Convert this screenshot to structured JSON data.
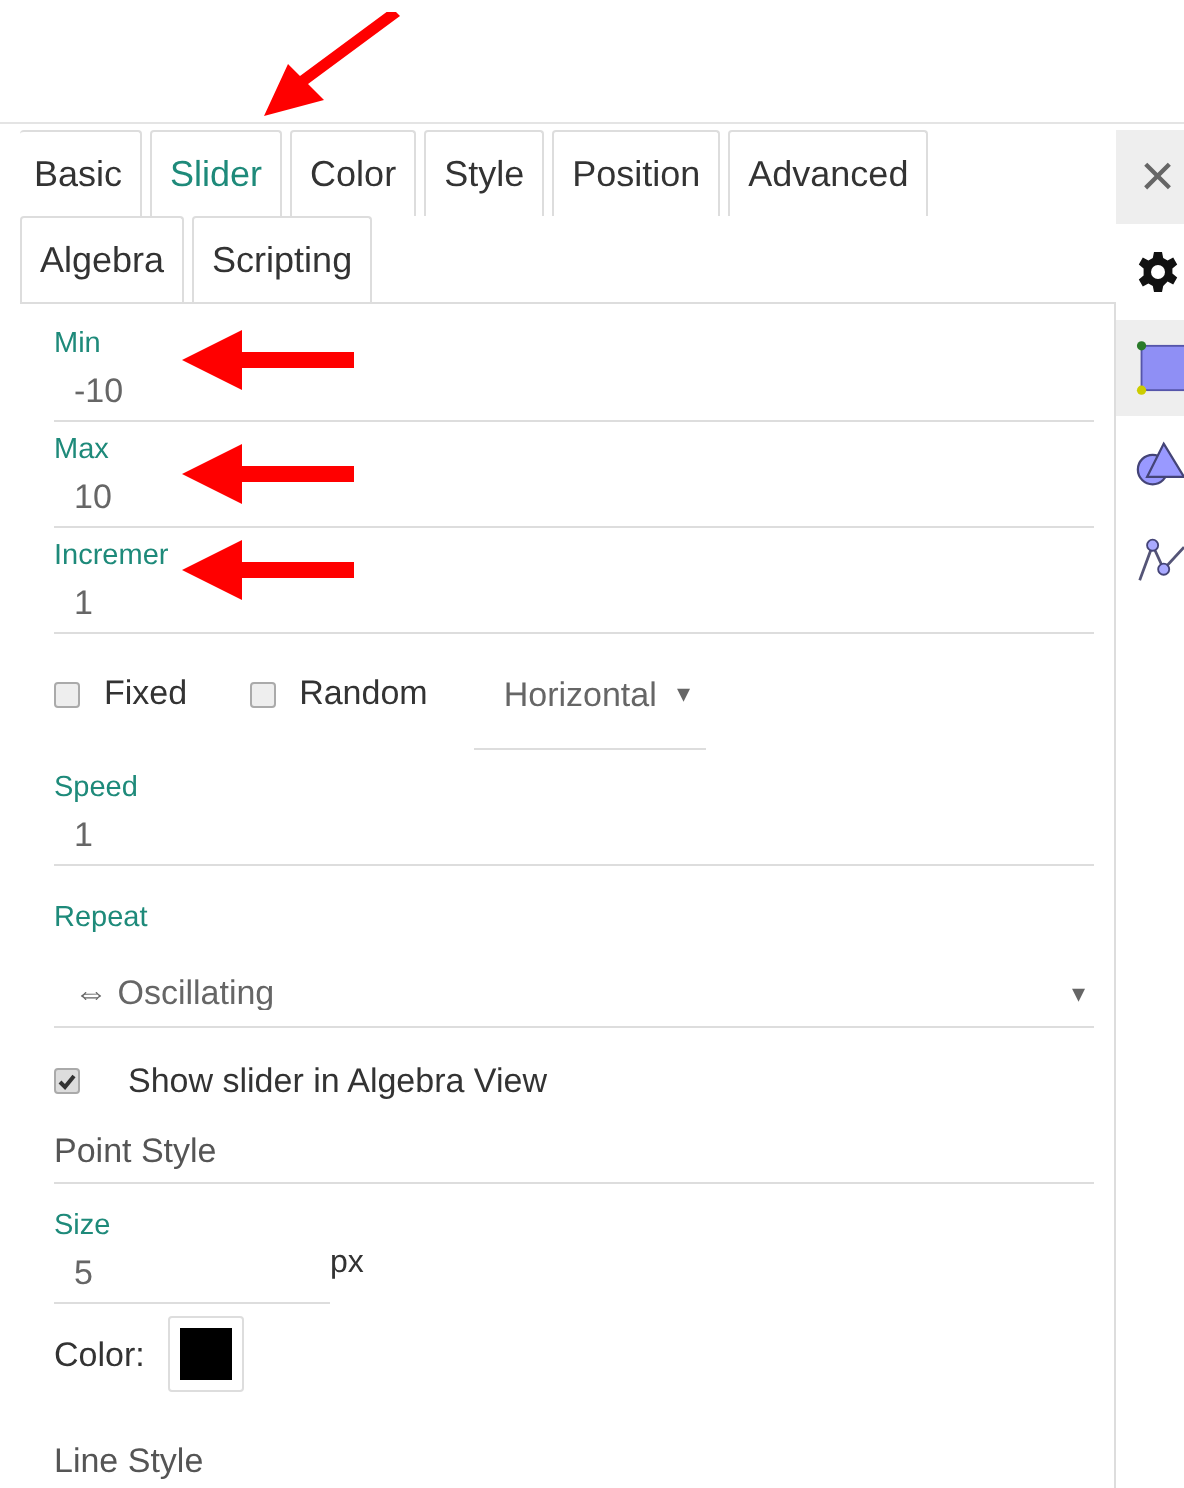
{
  "tabs": [
    {
      "label": "Basic",
      "selected": false
    },
    {
      "label": "Slider",
      "selected": true
    },
    {
      "label": "Color",
      "selected": false
    },
    {
      "label": "Style",
      "selected": false
    },
    {
      "label": "Position",
      "selected": false
    },
    {
      "label": "Advanced",
      "selected": false
    },
    {
      "label": "Algebra",
      "selected": false
    },
    {
      "label": "Scripting",
      "selected": false
    }
  ],
  "range_fields": [
    {
      "label": "Min",
      "value": "-10"
    },
    {
      "label": "Max",
      "value": "10"
    },
    {
      "label": "Incremer",
      "value": "1"
    }
  ],
  "options": [
    {
      "label": "Fixed",
      "checked": false
    },
    {
      "label": "Random",
      "checked": false
    }
  ],
  "orientation": {
    "value": "Horizontal",
    "arrow": "▾"
  },
  "speed": {
    "label": "Speed",
    "value": "1"
  },
  "repeat": {
    "label": "Repeat",
    "value": "⇔ Oscillating",
    "arrow": "▾"
  },
  "show_in_algebra": {
    "label": "Show slider in Algebra View",
    "checked": true
  },
  "point_style": {
    "title": "Point Style",
    "size_label": "Size",
    "size_value": "5",
    "unit": "px",
    "color_label": "Color:",
    "color": "#000000"
  },
  "line_style": {
    "title": "Line Style"
  },
  "close": "×",
  "side_tools": [
    {
      "kind": "gear",
      "selected": false
    },
    {
      "kind": "rectangle",
      "selected": true
    },
    {
      "kind": "shapes",
      "selected": false
    },
    {
      "kind": "curve",
      "selected": false
    }
  ]
}
